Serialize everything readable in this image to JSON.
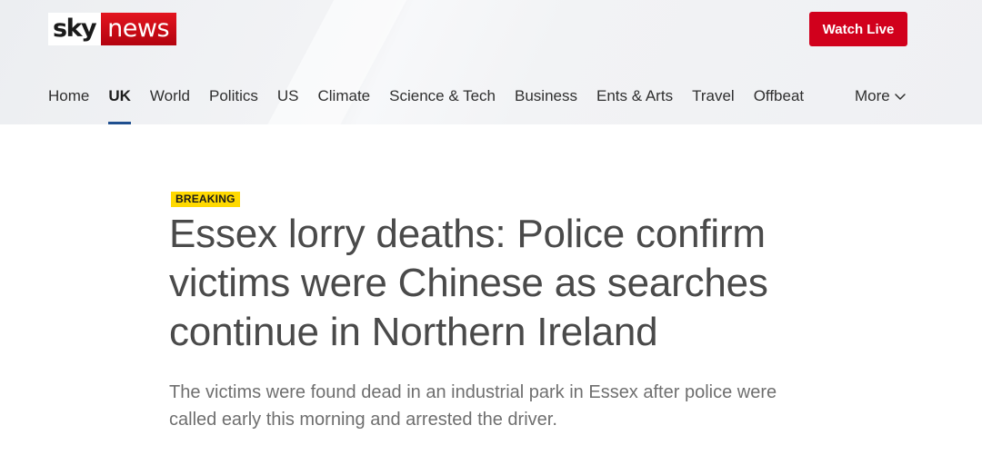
{
  "header": {
    "logo": {
      "sky": "sky",
      "news": "news"
    },
    "watch_live_label": "Watch Live",
    "nav": {
      "items": [
        {
          "label": "Home"
        },
        {
          "label": "UK",
          "active": true
        },
        {
          "label": "World"
        },
        {
          "label": "Politics"
        },
        {
          "label": "US"
        },
        {
          "label": "Climate"
        },
        {
          "label": "Science & Tech"
        },
        {
          "label": "Business"
        },
        {
          "label": "Ents & Arts"
        },
        {
          "label": "Travel"
        },
        {
          "label": "Offbeat"
        }
      ],
      "more_label": "More",
      "more_icon": "chevron-down-icon"
    }
  },
  "article": {
    "badge": "BREAKING",
    "headline": "Essex lorry deaths: Police confirm victims were Chinese as searches continue in Northern Ireland",
    "standfirst": "The victims were found dead in an industrial park in Essex after police were called early this morning and arrested the driver."
  },
  "colors": {
    "brand_red": "#d1001c",
    "breaking_yellow": "#ffd900",
    "nav_underline": "#1f4f8f"
  }
}
